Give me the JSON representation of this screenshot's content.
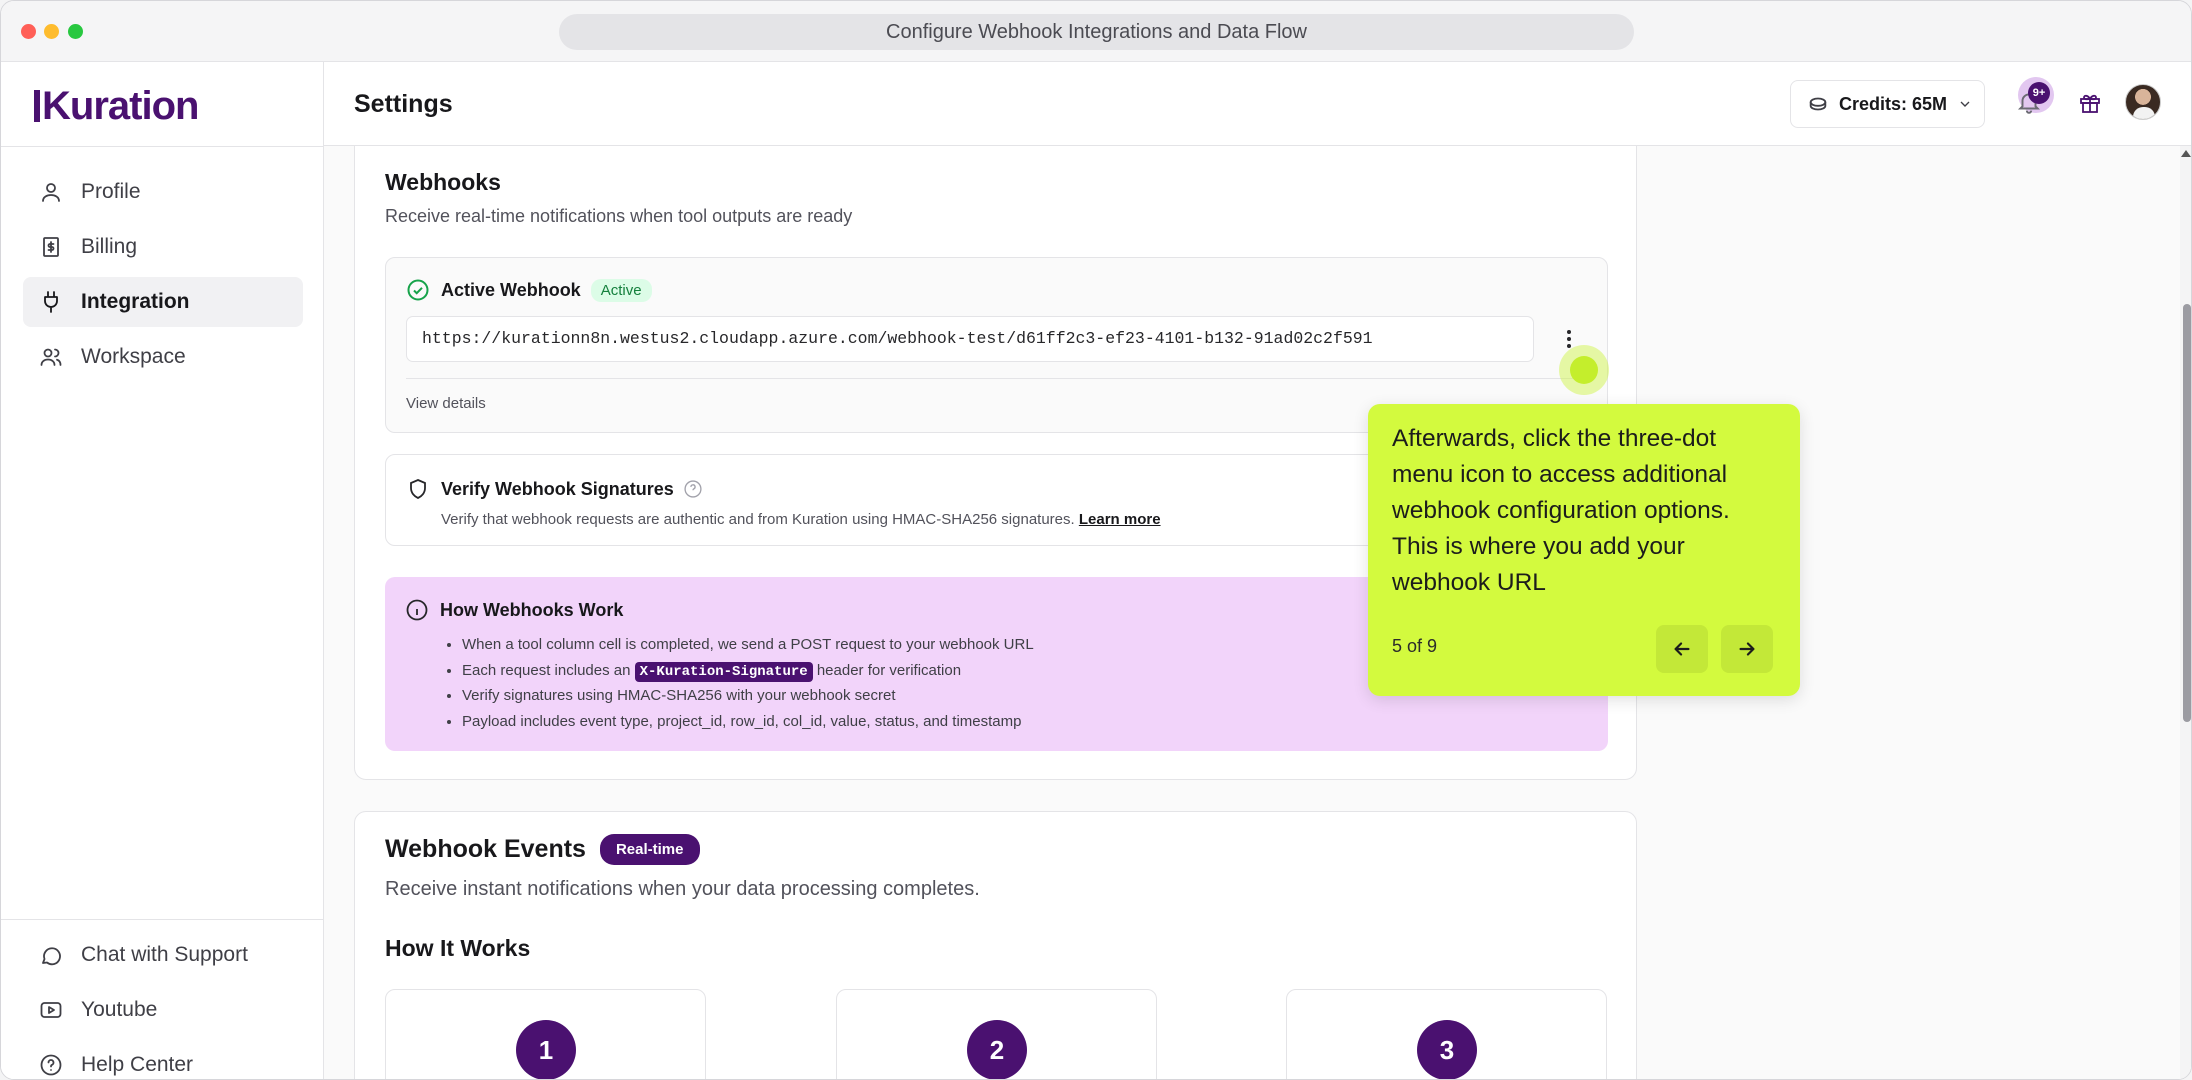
{
  "window": {
    "url_title": "Configure Webhook Integrations and Data Flow"
  },
  "brand": {
    "logo": "uration",
    "logo_initial": "K"
  },
  "sidebar": {
    "items": [
      {
        "label": "Profile",
        "icon": "user-icon"
      },
      {
        "label": "Billing",
        "icon": "receipt-icon"
      },
      {
        "label": "Integration",
        "icon": "plug-icon",
        "active": true
      },
      {
        "label": "Workspace",
        "icon": "users-icon"
      }
    ],
    "footer": [
      {
        "label": "Chat with Support",
        "icon": "chat-icon"
      },
      {
        "label": "Youtube",
        "icon": "youtube-icon"
      },
      {
        "label": "Help Center",
        "icon": "help-icon"
      }
    ]
  },
  "header": {
    "title": "Settings",
    "credits_label": "Credits: 65M",
    "notification_badge": "9+"
  },
  "webhooks": {
    "title": "Webhooks",
    "subtitle": "Receive real-time notifications when tool outputs are ready",
    "active": {
      "title": "Active Webhook",
      "status": "Active",
      "url": "https://kurationn8n.westus2.cloudapp.azure.com/webhook-test/d61ff2c3-ef23-4101-b132-91ad02c2f591",
      "view_details": "View details"
    },
    "verify": {
      "title": "Verify Webhook Signatures",
      "description": "Verify that webhook requests are authentic and from Kuration using HMAC-SHA256 signatures.",
      "learn_more": "Learn more"
    },
    "how": {
      "title": "How Webhooks Work",
      "items": [
        "When a tool column cell is completed, we send a POST request to your webhook URL",
        "Each request includes an",
        "Verify signatures using HMAC-SHA256 with your webhook secret",
        "Payload includes event type, project_id, row_id, col_id, value, status, and timestamp"
      ],
      "header_name": "X-Kuration-Signature",
      "header_suffix": "header for verification"
    }
  },
  "events": {
    "title": "Webhook Events",
    "badge": "Real-time",
    "subtitle": "Receive instant notifications when your data processing completes.",
    "how_it_works": "How It Works",
    "steps": [
      "1",
      "2",
      "3"
    ]
  },
  "tour": {
    "text": "Afterwards, click the three-dot menu icon to access additional webhook configuration options. This is where you add your webhook URL",
    "progress": "5 of 9"
  },
  "colors": {
    "brand": "#4a1170",
    "tooltip": "#d3fa3e",
    "active_green": "#16a34a",
    "info_panel": "#f2d4fa"
  }
}
